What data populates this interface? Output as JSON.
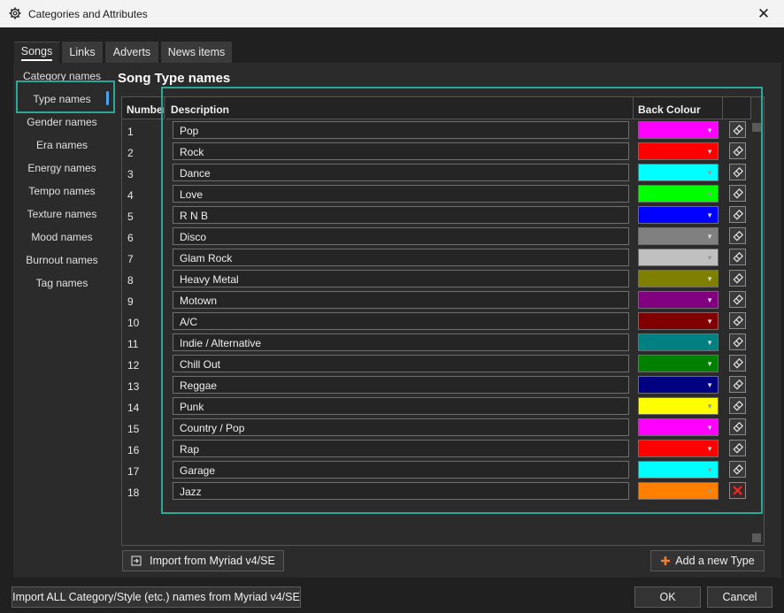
{
  "window": {
    "title": "Categories and Attributes",
    "close_glyph": "✕"
  },
  "tabs": [
    {
      "label": "Songs",
      "active": true
    },
    {
      "label": "Links",
      "active": false
    },
    {
      "label": "Adverts",
      "active": false
    },
    {
      "label": "News items",
      "active": false
    }
  ],
  "sidebar": {
    "selected": "Type names",
    "items": [
      {
        "label": "Category names"
      },
      {
        "label": "Type names"
      },
      {
        "label": "Gender names"
      },
      {
        "label": "Era names"
      },
      {
        "label": "Energy names"
      },
      {
        "label": "Tempo names"
      },
      {
        "label": "Texture names"
      },
      {
        "label": "Mood names"
      },
      {
        "label": "Burnout names"
      },
      {
        "label": "Tag names"
      }
    ]
  },
  "main": {
    "heading": "Song Type names",
    "columns": {
      "number": "Number",
      "description": "Description",
      "back_colour": "Back Colour"
    },
    "rows": [
      {
        "number": "1",
        "description": "Pop",
        "color": "#ff00ff",
        "action": "edit"
      },
      {
        "number": "2",
        "description": "Rock",
        "color": "#ff0000",
        "action": "edit"
      },
      {
        "number": "3",
        "description": "Dance",
        "color": "#00ffff",
        "action": "edit"
      },
      {
        "number": "4",
        "description": "Love",
        "color": "#00ff00",
        "action": "edit"
      },
      {
        "number": "5",
        "description": "R N B",
        "color": "#0000ff",
        "action": "edit"
      },
      {
        "number": "6",
        "description": "Disco",
        "color": "#808080",
        "action": "edit"
      },
      {
        "number": "7",
        "description": "Glam Rock",
        "color": "#c0c0c0",
        "action": "edit"
      },
      {
        "number": "8",
        "description": "Heavy Metal",
        "color": "#808000",
        "action": "edit"
      },
      {
        "number": "9",
        "description": "Motown",
        "color": "#800080",
        "action": "edit"
      },
      {
        "number": "10",
        "description": "A/C",
        "color": "#800000",
        "action": "edit"
      },
      {
        "number": "11",
        "description": "Indie / Alternative",
        "color": "#008080",
        "action": "edit"
      },
      {
        "number": "12",
        "description": "Chill Out",
        "color": "#008000",
        "action": "edit"
      },
      {
        "number": "13",
        "description": "Reggae",
        "color": "#000080",
        "action": "edit"
      },
      {
        "number": "14",
        "description": "Punk",
        "color": "#ffff00",
        "action": "edit"
      },
      {
        "number": "15",
        "description": "Country / Pop",
        "color": "#ff00ff",
        "action": "edit"
      },
      {
        "number": "16",
        "description": "Rap",
        "color": "#ff0000",
        "action": "edit"
      },
      {
        "number": "17",
        "description": "Garage",
        "color": "#00ffff",
        "action": "edit"
      },
      {
        "number": "18",
        "description": "Jazz",
        "color": "#ff8000",
        "action": "delete"
      }
    ],
    "import_button": "Import from Myriad v4/SE",
    "add_button": "Add a new Type"
  },
  "footer": {
    "import_all_button": "Import ALL Category/Style (etc.) names from Myriad v4/SE",
    "ok_button": "OK",
    "cancel_button": "Cancel"
  },
  "accent_colors": {
    "highlight_box": "#2aa898",
    "add_icon": "#f08030",
    "selection": "#4aa3f0"
  }
}
